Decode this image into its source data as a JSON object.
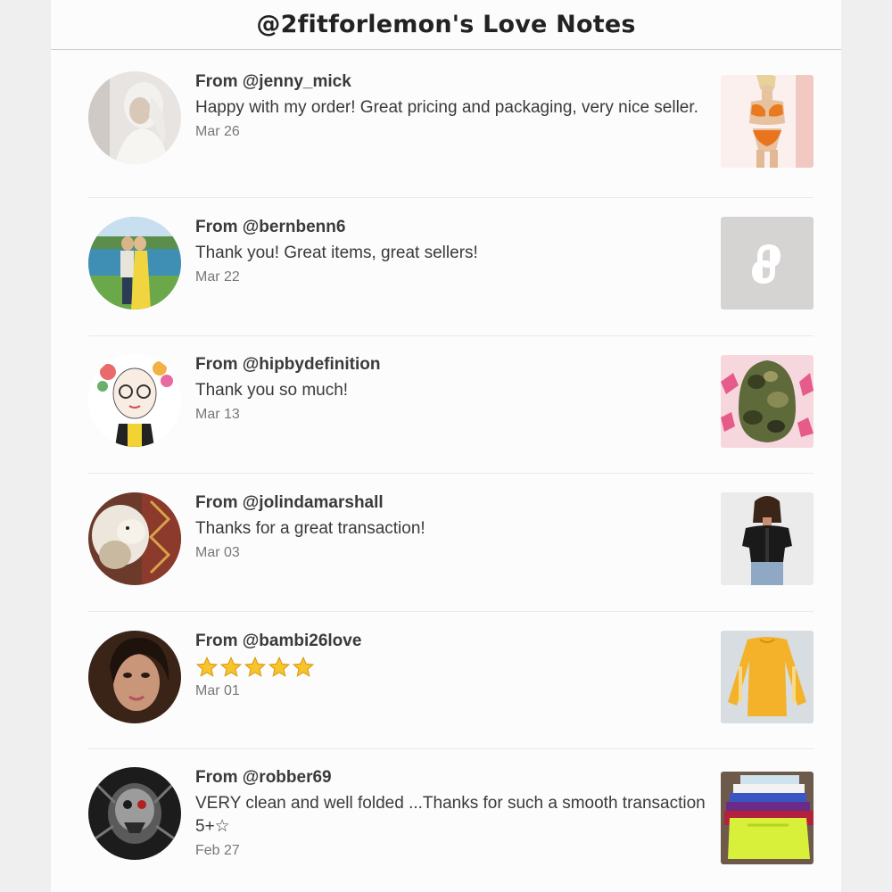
{
  "header": {
    "title": "@2fitforlemon's Love Notes"
  },
  "notes": [
    {
      "from": "From @jenny_mick",
      "message": "Happy with my order! Great pricing and packaging, very nice seller.",
      "date": "Mar 26",
      "rating": null,
      "thumb_icon": "orange-bikini-listing"
    },
    {
      "from": "From @bernbenn6",
      "message": "Thank you! Great items, great sellers!",
      "date": "Mar 22",
      "rating": null,
      "thumb_icon": "poshmark-logo-placeholder"
    },
    {
      "from": "From @hipbydefinition",
      "message": "Thank you so much!",
      "date": "Mar 13",
      "rating": null,
      "thumb_icon": "camo-hat-listing"
    },
    {
      "from": "From @jolindamarshall",
      "message": "Thanks for a great transaction!",
      "date": "Mar 03",
      "rating": null,
      "thumb_icon": "black-crop-top-listing"
    },
    {
      "from": "From @bambi26love",
      "message": "",
      "date": "Mar 01",
      "rating": 5,
      "thumb_icon": "yellow-sweatshirt-listing"
    },
    {
      "from": "From @robber69",
      "message": "VERY clean and well folded ...Thanks for such a smooth transaction 5+☆",
      "date": "Feb 27",
      "rating": null,
      "thumb_icon": "folded-shirts-listing"
    }
  ],
  "colors": {
    "star": "#f7c52b",
    "placeholder_bg": "#d6d4d2"
  }
}
